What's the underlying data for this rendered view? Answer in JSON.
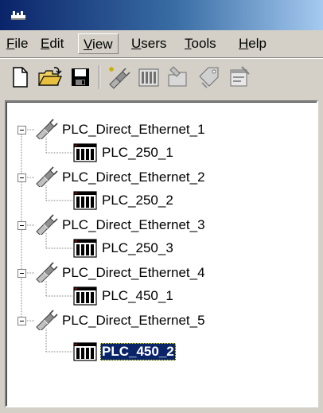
{
  "window": {
    "icon": "app-plug-icon",
    "title": ""
  },
  "menu": {
    "items": [
      {
        "mnemonic": "F",
        "rest": "ile"
      },
      {
        "mnemonic": "E",
        "rest": "dit"
      },
      {
        "mnemonic": "V",
        "rest": "iew"
      },
      {
        "mnemonic": "U",
        "rest": "sers"
      },
      {
        "mnemonic": "T",
        "rest": "ools"
      },
      {
        "mnemonic": "H",
        "rest": "elp"
      }
    ],
    "active_item": "View"
  },
  "toolbar": {
    "buttons": [
      "new-document-icon",
      "open-folder-icon",
      "save-icon",
      "new-channel-icon",
      "new-device-icon",
      "new-tag-group-icon",
      "new-tag-icon",
      "properties-icon"
    ]
  },
  "tree": {
    "selection_color": "#0a246a",
    "channels": [
      {
        "label": "PLC_Direct_Ethernet_1",
        "device": "PLC_250_1"
      },
      {
        "label": "PLC_Direct_Ethernet_2",
        "device": "PLC_250_2"
      },
      {
        "label": "PLC_Direct_Ethernet_3",
        "device": "PLC_250_3"
      },
      {
        "label": "PLC_Direct_Ethernet_4",
        "device": "PLC_450_1"
      },
      {
        "label": "PLC_Direct_Ethernet_5",
        "device": "PLC_450_2"
      }
    ],
    "selected_device": "PLC_450_2"
  }
}
